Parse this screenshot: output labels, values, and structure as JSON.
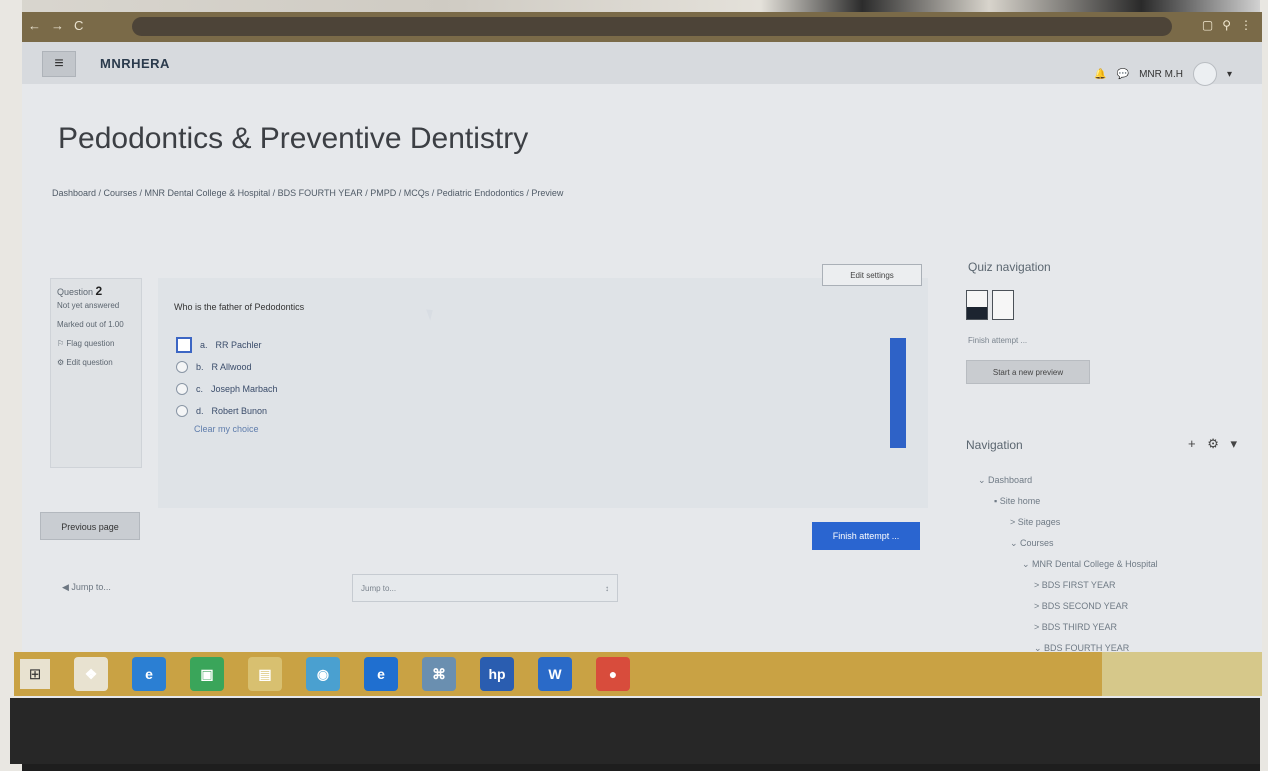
{
  "window": {
    "nav_back": "←",
    "nav_forward": "→",
    "nav_reload": "C"
  },
  "header": {
    "menu_icon": "≡",
    "site_name": "MNRHERA",
    "username": "MNR M.H",
    "page_title": "Pedodontics & Preventive Dentistry",
    "breadcrumb": "Dashboard / Courses / MNR Dental College & Hospital / BDS FOURTH YEAR / PMPD / MCQs / Pediatric Endodontics / Preview"
  },
  "question_info": {
    "label": "Question",
    "number": "2",
    "status": "Not yet answered",
    "marks": "Marked out of 1.00",
    "flag": "Flag question",
    "edit": "Edit question"
  },
  "question": {
    "text": "Who is the father of Pedodontics",
    "answers": [
      {
        "letter": "a.",
        "text": "RR Pachler",
        "selected": true
      },
      {
        "letter": "b.",
        "text": "R Allwood",
        "selected": false
      },
      {
        "letter": "c.",
        "text": "Joseph Marbach",
        "selected": false
      },
      {
        "letter": "d.",
        "text": "Robert Bunon",
        "selected": false
      }
    ],
    "clear_choice": "Clear my choice"
  },
  "buttons": {
    "edit_settings": "Edit settings",
    "previous_page": "Previous page",
    "finish_attempt": "Finish attempt ...",
    "jump_label": "◀ Jump to...",
    "jump_to": "Jump to...",
    "jump_arrow": "↕"
  },
  "quiz_navigation": {
    "title": "Quiz navigation",
    "finish_attempt": "Finish attempt ...",
    "start_new_preview": "Start a new preview"
  },
  "navigation": {
    "title": "Navigation",
    "controls": "+ ⚙ ▾",
    "tree": [
      {
        "label": "⌄ Dashboard",
        "level": 1
      },
      {
        "label": "▪ Site home",
        "level": 2
      },
      {
        "label": "> Site pages",
        "level": 3
      },
      {
        "label": "⌄ Courses",
        "level": 3
      },
      {
        "label": "⌄ MNR Dental College & Hospital",
        "level": 4
      },
      {
        "label": "> BDS FIRST YEAR",
        "level": 5
      },
      {
        "label": "> BDS SECOND YEAR",
        "level": 5
      },
      {
        "label": "> BDS THIRD YEAR",
        "level": 5
      },
      {
        "label": "⌄ BDS FOURTH YEAR",
        "level": 5
      }
    ]
  },
  "taskbar": {
    "icons": [
      "❖",
      "e",
      "▣",
      "▤",
      "◉",
      "e",
      "⌘",
      "hp",
      "W",
      "●"
    ],
    "icon_colors": [
      "#e8e2d0",
      "#2b7fd3",
      "#3aa55a",
      "#d8c070",
      "#4aa0d0",
      "#1f6fd0",
      "#6a8fb0",
      "#2a5db0",
      "#2a6ac8",
      "#d84c3c"
    ],
    "tray_time": "",
    "tray_date": ""
  },
  "colors": {
    "primary_button": "#2a65d0",
    "scroll_indicator": "#2e62c7",
    "taskbar": "#c9a244"
  }
}
